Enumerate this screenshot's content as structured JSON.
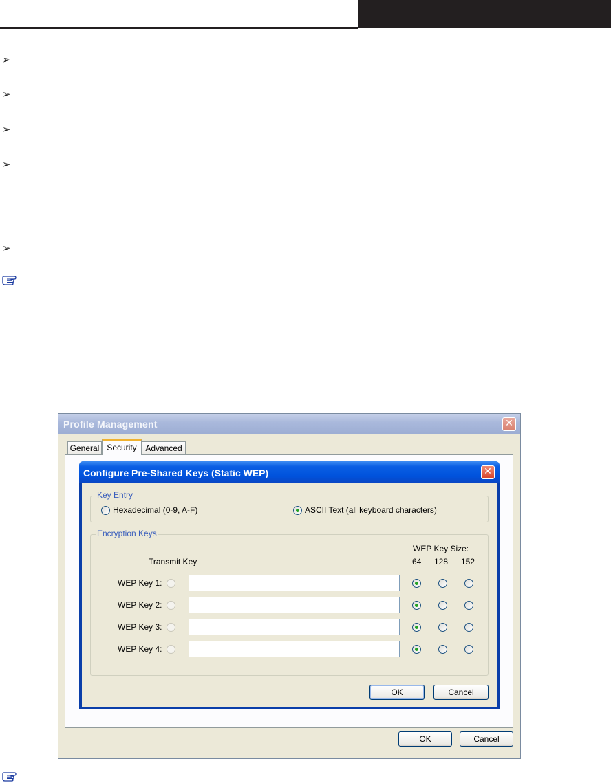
{
  "page": {
    "bullet_glyph": "➢",
    "note_icon": "pointing-hand-icon"
  },
  "window": {
    "title": "Profile Management",
    "tabs": [
      "General",
      "Security",
      "Advanced"
    ],
    "selected_tab": "Security",
    "ok_label": "OK",
    "cancel_label": "Cancel"
  },
  "dialog": {
    "title": "Configure Pre-Shared Keys (Static WEP)",
    "key_entry": {
      "legend": "Key Entry",
      "options": [
        "Hexadecimal (0-9, A-F)",
        "ASCII Text (all keyboard characters)"
      ],
      "selected": "ASCII Text (all keyboard characters)"
    },
    "encryption_keys": {
      "legend": "Encryption Keys",
      "transmit_key_label": "Transmit Key",
      "key_size_label": "WEP Key Size:",
      "sizes": [
        "64",
        "128",
        "152"
      ],
      "keys": [
        {
          "label": "WEP Key 1:",
          "value": "",
          "size": "64"
        },
        {
          "label": "WEP Key 2:",
          "value": "",
          "size": "64"
        },
        {
          "label": "WEP Key 3:",
          "value": "",
          "size": "64"
        },
        {
          "label": "WEP Key 4:",
          "value": "",
          "size": "64"
        }
      ]
    },
    "ok_label": "OK",
    "cancel_label": "Cancel"
  },
  "colors": {
    "header_bar": "#231f20",
    "dialog_title": "#0a5fe4",
    "legend_text": "#3a5ebc",
    "radio_dot": "#21a121"
  }
}
